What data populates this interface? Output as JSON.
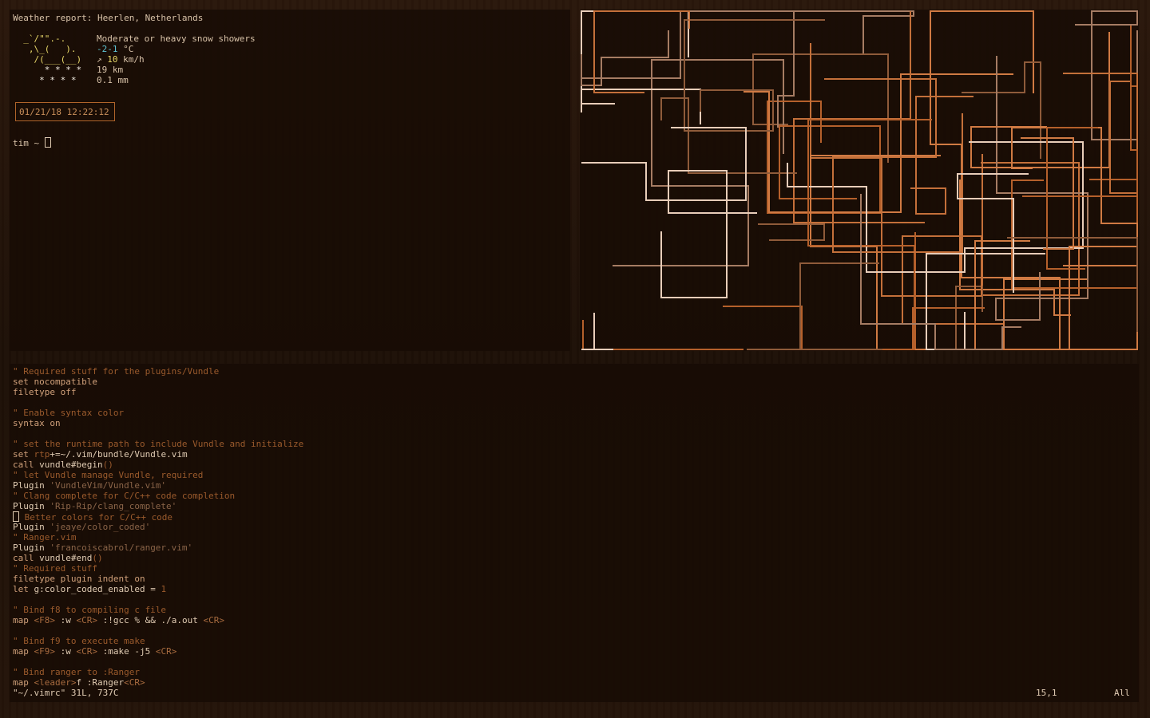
{
  "weather": {
    "title": "Weather report: Heerlen, Netherlands",
    "art": {
      "line1": "  _`/\"\".-.    ",
      "line2": "   ,\\_(   ).  ",
      "line3": "    /(___(__) ",
      "line4": "      * * * *  ",
      "line5": "     * * * *   "
    },
    "condition": "Moderate or heavy snow showers",
    "temp_value": "-2-1",
    "temp_unit": " °C",
    "wind_arrow": "↗ ",
    "wind_value": "10",
    "wind_unit": " km/h",
    "visibility": "19 km",
    "precip": "0.1 mm"
  },
  "clock": {
    "datetime": "01/21/18 12:22:12"
  },
  "shell": {
    "prompt": "tim ~ "
  },
  "pipes": {
    "colors": [
      "#b5602b",
      "#d07a43",
      "#8f5b3a",
      "#e8cdb9",
      "#a67c63",
      "#c4703a"
    ]
  },
  "vim": {
    "lines": [
      [
        {
          "t": "\" Required stuff for the plugins/Vundle",
          "c": "cm"
        }
      ],
      [
        {
          "t": "set ",
          "c": "kw"
        },
        {
          "t": "nocompatible",
          "c": "kw"
        }
      ],
      [
        {
          "t": "filetype ",
          "c": "kw"
        },
        {
          "t": "off",
          "c": "kw"
        }
      ],
      [],
      [
        {
          "t": "\" Enable syntax color",
          "c": "cm"
        }
      ],
      [
        {
          "t": "syntax ",
          "c": "kw"
        },
        {
          "t": "on",
          "c": "kw"
        }
      ],
      [],
      [
        {
          "t": "\" set the runtime path to include Vundle and initialize",
          "c": "cm"
        }
      ],
      [
        {
          "t": "set ",
          "c": "kw"
        },
        {
          "t": "rtp",
          "c": "cm"
        },
        {
          "t": "+=~/.vim/bundle/Vundle.vim",
          "c": "tx"
        }
      ],
      [
        {
          "t": "call ",
          "c": "kw"
        },
        {
          "t": "vundle#begin",
          "c": "tx"
        },
        {
          "t": "()",
          "c": "cm"
        }
      ],
      [
        {
          "t": "\" let Vundle manage Vundle, required",
          "c": "cm"
        }
      ],
      [
        {
          "t": "Plugin ",
          "c": "tx"
        },
        {
          "t": "'VundleVim/Vundle.vim'",
          "c": "st"
        }
      ],
      [
        {
          "t": "\" Clang complete for C/C++ code completion",
          "c": "cm"
        }
      ],
      [
        {
          "t": "Plugin ",
          "c": "tx"
        },
        {
          "t": "'Rip-Rip/clang_complete'",
          "c": "st"
        }
      ],
      [
        {
          "t": "CURSOR",
          "c": "cursor"
        },
        {
          "t": " Better colors for C/C++ code",
          "c": "cm"
        }
      ],
      [
        {
          "t": "Plugin ",
          "c": "tx"
        },
        {
          "t": "'jeaye/color_coded'",
          "c": "st"
        }
      ],
      [
        {
          "t": "\" Ranger.vim",
          "c": "cm"
        }
      ],
      [
        {
          "t": "Plugin ",
          "c": "tx"
        },
        {
          "t": "'francoiscabrol/ranger.vim'",
          "c": "st"
        }
      ],
      [
        {
          "t": "call ",
          "c": "kw"
        },
        {
          "t": "vundle#end",
          "c": "tx"
        },
        {
          "t": "()",
          "c": "cm"
        }
      ],
      [
        {
          "t": "\" Required stuff",
          "c": "cm"
        }
      ],
      [
        {
          "t": "filetype plugin indent on",
          "c": "kw"
        }
      ],
      [
        {
          "t": "let ",
          "c": "kw"
        },
        {
          "t": "g:color_coded_enabled = ",
          "c": "tx"
        },
        {
          "t": "1",
          "c": "cm"
        }
      ],
      [],
      [
        {
          "t": "\" Bind f8 to compiling c file",
          "c": "cm"
        }
      ],
      [
        {
          "t": "map ",
          "c": "kw"
        },
        {
          "t": "<F8>",
          "c": "cr"
        },
        {
          "t": " :w ",
          "c": "tx"
        },
        {
          "t": "<CR>",
          "c": "cr"
        },
        {
          "t": " :!gcc % && ./a.out ",
          "c": "tx"
        },
        {
          "t": "<CR>",
          "c": "cr"
        }
      ],
      [],
      [
        {
          "t": "\" Bind f9 to execute make",
          "c": "cm"
        }
      ],
      [
        {
          "t": "map ",
          "c": "kw"
        },
        {
          "t": "<F9>",
          "c": "cr"
        },
        {
          "t": " :w ",
          "c": "tx"
        },
        {
          "t": "<CR>",
          "c": "cr"
        },
        {
          "t": " :make -j5 ",
          "c": "tx"
        },
        {
          "t": "<CR>",
          "c": "cr"
        }
      ],
      [],
      [
        {
          "t": "\" Bind ranger to :Ranger",
          "c": "cm"
        }
      ],
      [
        {
          "t": "map ",
          "c": "kw"
        },
        {
          "t": "<leader>",
          "c": "cr"
        },
        {
          "t": "f :Ranger",
          "c": "tx"
        },
        {
          "t": "<CR>",
          "c": "cr"
        }
      ]
    ],
    "status_message": "\"~/.vimrc\" 31L, 737C",
    "cursor_pos": "15,1",
    "scroll_pos": "All"
  }
}
